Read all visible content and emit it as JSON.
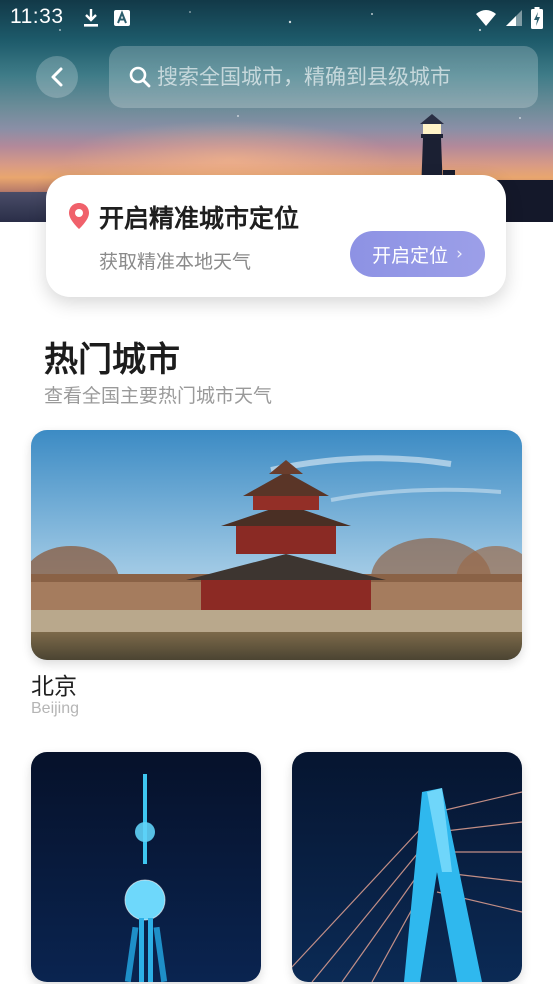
{
  "status_bar": {
    "time": "11:33",
    "left_icons": [
      "download-icon",
      "text-a-icon"
    ],
    "right_icons": [
      "wifi-icon",
      "signal-icon",
      "battery-charging-icon"
    ]
  },
  "nav": {
    "back_icon": "chevron-left-icon",
    "search": {
      "icon": "search-icon",
      "placeholder": "搜索全国城市，精确到县级城市"
    }
  },
  "location_card": {
    "icon": "location-pin-icon",
    "title": "开启精准城市定位",
    "subtitle": "获取精准本地天气",
    "button_label": "开启定位",
    "button_icon": "chevron-right-icon"
  },
  "hot_cities": {
    "title": "热门城市",
    "subtitle": "查看全国主要热门城市天气",
    "items": [
      {
        "name": "北京",
        "pinyin": "Beijing"
      },
      {
        "name": "",
        "pinyin": ""
      },
      {
        "name": "",
        "pinyin": ""
      }
    ]
  },
  "colors": {
    "accent_button": "#8d92e4",
    "pin": "#f0616b",
    "title_text": "#1f1f1f",
    "muted_text": "#9a9a9a"
  }
}
